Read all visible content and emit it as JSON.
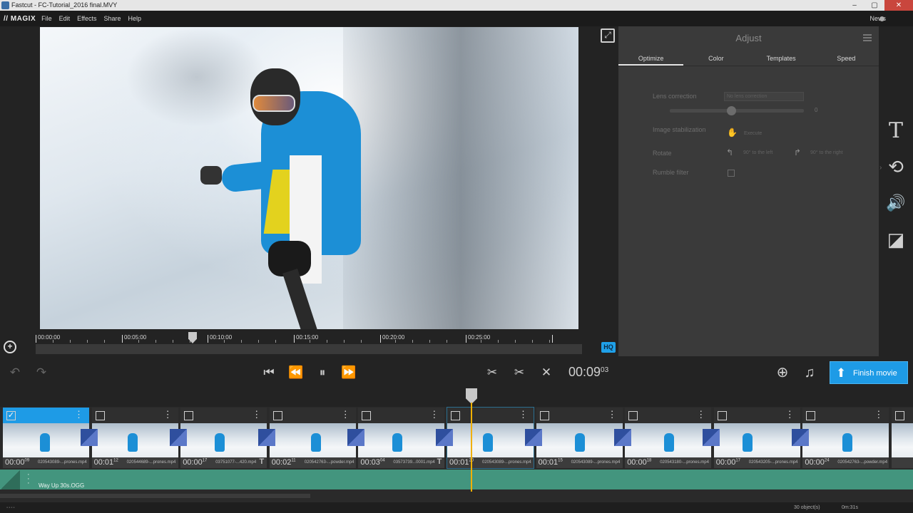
{
  "window": {
    "title": "Fastcut - FC-Tutorial_2016 final.MVY",
    "controls": [
      "–",
      "▢",
      "✕"
    ]
  },
  "brand": {
    "logo": "// MAGIX"
  },
  "menu": {
    "items": [
      "File",
      "Edit",
      "Effects",
      "Share",
      "Help"
    ],
    "news": "News"
  },
  "preview": {
    "expand_icon": "⤢",
    "zoom_icon": "+",
    "hq_badge": "HQ",
    "ruler_labels": [
      "00:00:00",
      "00:05:00",
      "00:10:00",
      "00:15:00",
      "00:20:00",
      "00:25:00"
    ]
  },
  "adjust": {
    "title": "Adjust",
    "tabs": [
      "Optimize",
      "Color",
      "Templates",
      "Speed"
    ],
    "active_tab": "Optimize",
    "lens_correction": {
      "label": "Lens correction",
      "select_value": "No lens correction",
      "slider_value": "0",
      "slider_fraction": 0.46
    },
    "image_stabilization": {
      "label": "Image stabilization",
      "action": "Execute"
    },
    "rotate": {
      "label": "Rotate",
      "left": "90° to the left",
      "right": "90° to the right"
    },
    "rumble_filter": {
      "label": "Rumble filter",
      "checked": false
    }
  },
  "tools": {
    "text": "T",
    "effects": "⟲",
    "audio": "🔊",
    "fade": "◪"
  },
  "transport": {
    "undo": "↶",
    "redo": "↷",
    "skip_back": "⏮",
    "rewind": "⏪",
    "pause": "⏸",
    "forward": "⏩",
    "cut_all": "✂",
    "cut": "✂",
    "delete": "✕",
    "timecode": "00:09",
    "timecode_frames": "03",
    "add_video": "⊕",
    "add_music": "♫",
    "finish_label": "Finish movie",
    "finish_icon": "⬆"
  },
  "clips": [
    {
      "time": "00:00",
      "frames": "09",
      "name": "020543089-...prones.mp4",
      "selected": true,
      "text_marker": false
    },
    {
      "time": "00:01",
      "frames": "12",
      "name": "020544689-...prones.mp4",
      "selected": false,
      "text_marker": false
    },
    {
      "time": "00:00",
      "frames": "17",
      "name": "03751077-...420.mp4",
      "selected": false,
      "text_marker": true
    },
    {
      "time": "00:02",
      "frames": "11",
      "name": "020542763-...powder.mp4",
      "selected": false,
      "text_marker": false
    },
    {
      "time": "00:03",
      "frames": "04",
      "name": "03573739...0001.mp4",
      "selected": false,
      "text_marker": true
    },
    {
      "time": "00:01",
      "frames": "20",
      "name": "020543089-...prones.mp4",
      "selected": false,
      "text_marker": false
    },
    {
      "time": "00:01",
      "frames": "15",
      "name": "020543089-...prones.mp4",
      "selected": false,
      "text_marker": false
    },
    {
      "time": "00:00",
      "frames": "18",
      "name": "020543180-...prones.mp4",
      "selected": false,
      "text_marker": false
    },
    {
      "time": "00:00",
      "frames": "17",
      "name": "020543205-...prones.mp4",
      "selected": false,
      "text_marker": false
    },
    {
      "time": "00:00",
      "frames": "24",
      "name": "020542763-...powder.mp4",
      "selected": false,
      "text_marker": false
    }
  ],
  "audio": {
    "name": "Way Up 30s.OGG"
  },
  "status": {
    "objects": "30 object(s)",
    "duration": "0m:31s",
    "grip": "▪▪▪▪"
  }
}
